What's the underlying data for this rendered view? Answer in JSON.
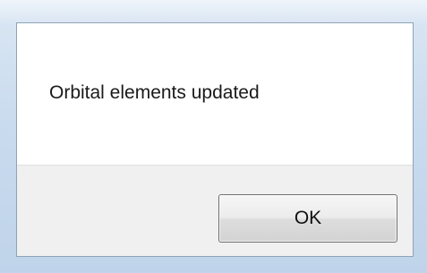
{
  "dialog": {
    "message": "Orbital elements updated",
    "ok_label": "OK"
  }
}
